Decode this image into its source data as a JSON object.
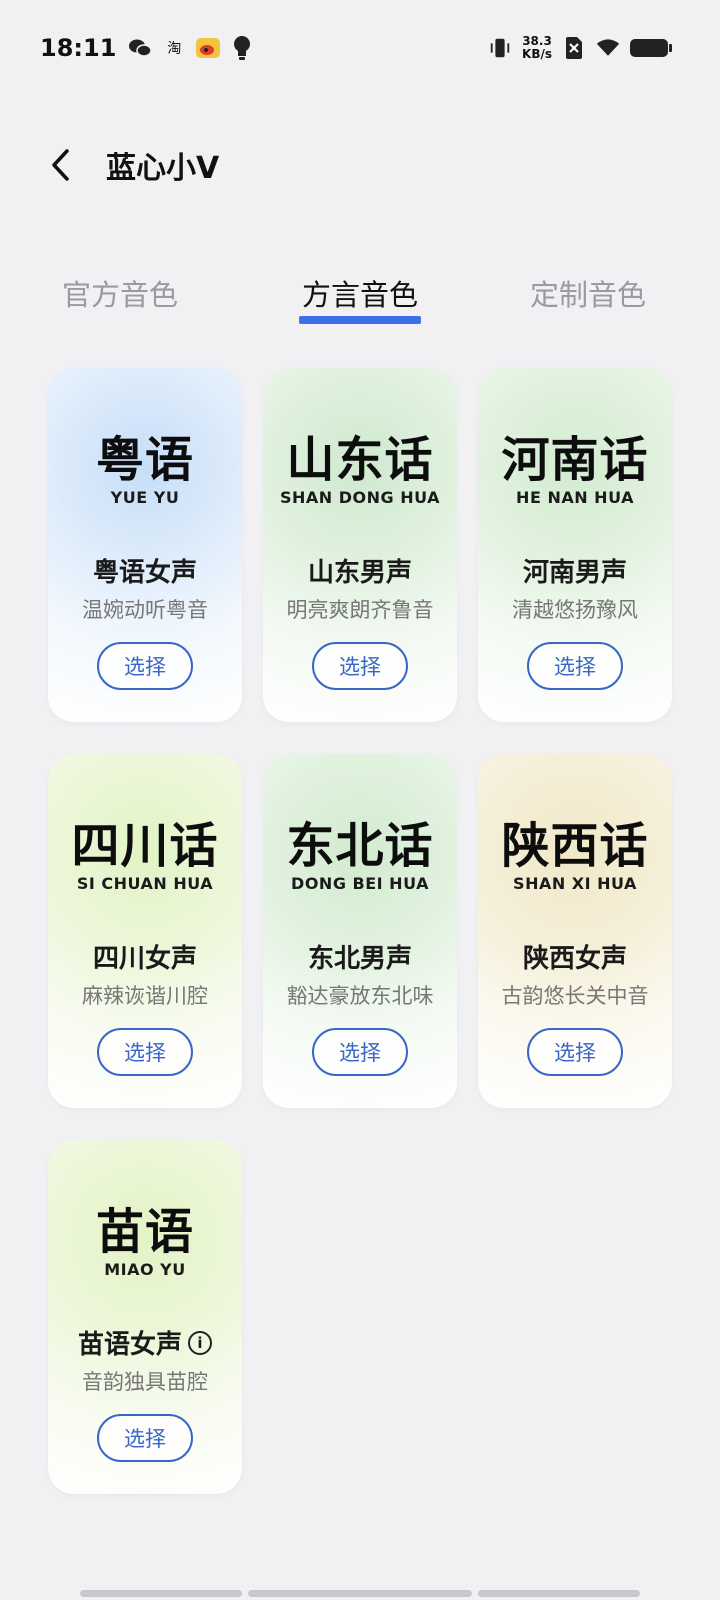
{
  "status_bar": {
    "time": "18:11",
    "left_icons": [
      "wechat-icon",
      "taobao-icon",
      "weibo-icon",
      "bulb-icon"
    ],
    "taobao_glyph": "淘",
    "net_speed_value": "38.3",
    "net_speed_unit": "KB/s"
  },
  "header": {
    "title": "蓝心小V"
  },
  "tabs": [
    {
      "label": "官方音色",
      "active": false
    },
    {
      "label": "方言音色",
      "active": true
    },
    {
      "label": "定制音色",
      "active": false
    }
  ],
  "cards": [
    {
      "calligraphy": "粤语",
      "pinyin": "YUE YU",
      "name": "粤语女声",
      "desc": "温婉动听粤音",
      "button": "选择",
      "tint": "#d6e8fb"
    },
    {
      "calligraphy": "山东话",
      "pinyin": "SHAN DONG HUA",
      "name": "山东男声",
      "desc": "明亮爽朗齐鲁音",
      "button": "选择",
      "tint": "#d9efd9"
    },
    {
      "calligraphy": "河南话",
      "pinyin": "HE NAN HUA",
      "name": "河南男声",
      "desc": "清越悠扬豫风",
      "button": "选择",
      "tint": "#dcf0da"
    },
    {
      "calligraphy": "四川话",
      "pinyin": "SI CHUAN HUA",
      "name": "四川女声",
      "desc": "麻辣诙谐川腔",
      "button": "选择",
      "tint": "#eaf6d2"
    },
    {
      "calligraphy": "东北话",
      "pinyin": "DONG BEI HUA",
      "name": "东北男声",
      "desc": "豁达豪放东北味",
      "button": "选择",
      "tint": "#dcf0da"
    },
    {
      "calligraphy": "陕西话",
      "pinyin": "SHAN XI HUA",
      "name": "陕西女声",
      "desc": "古韵悠长关中音",
      "button": "选择",
      "tint": "#f6efd8"
    },
    {
      "calligraphy": "苗语",
      "pinyin": "MIAO YU",
      "name": "苗语女声",
      "desc": "音韵独具苗腔",
      "button": "选择",
      "tint": "#eaf6d2",
      "has_info": true,
      "info_glyph": "i"
    }
  ],
  "colors": {
    "accent": "#3e6fe8",
    "button_border": "#3a66c8",
    "background": "#f1f1f4"
  }
}
